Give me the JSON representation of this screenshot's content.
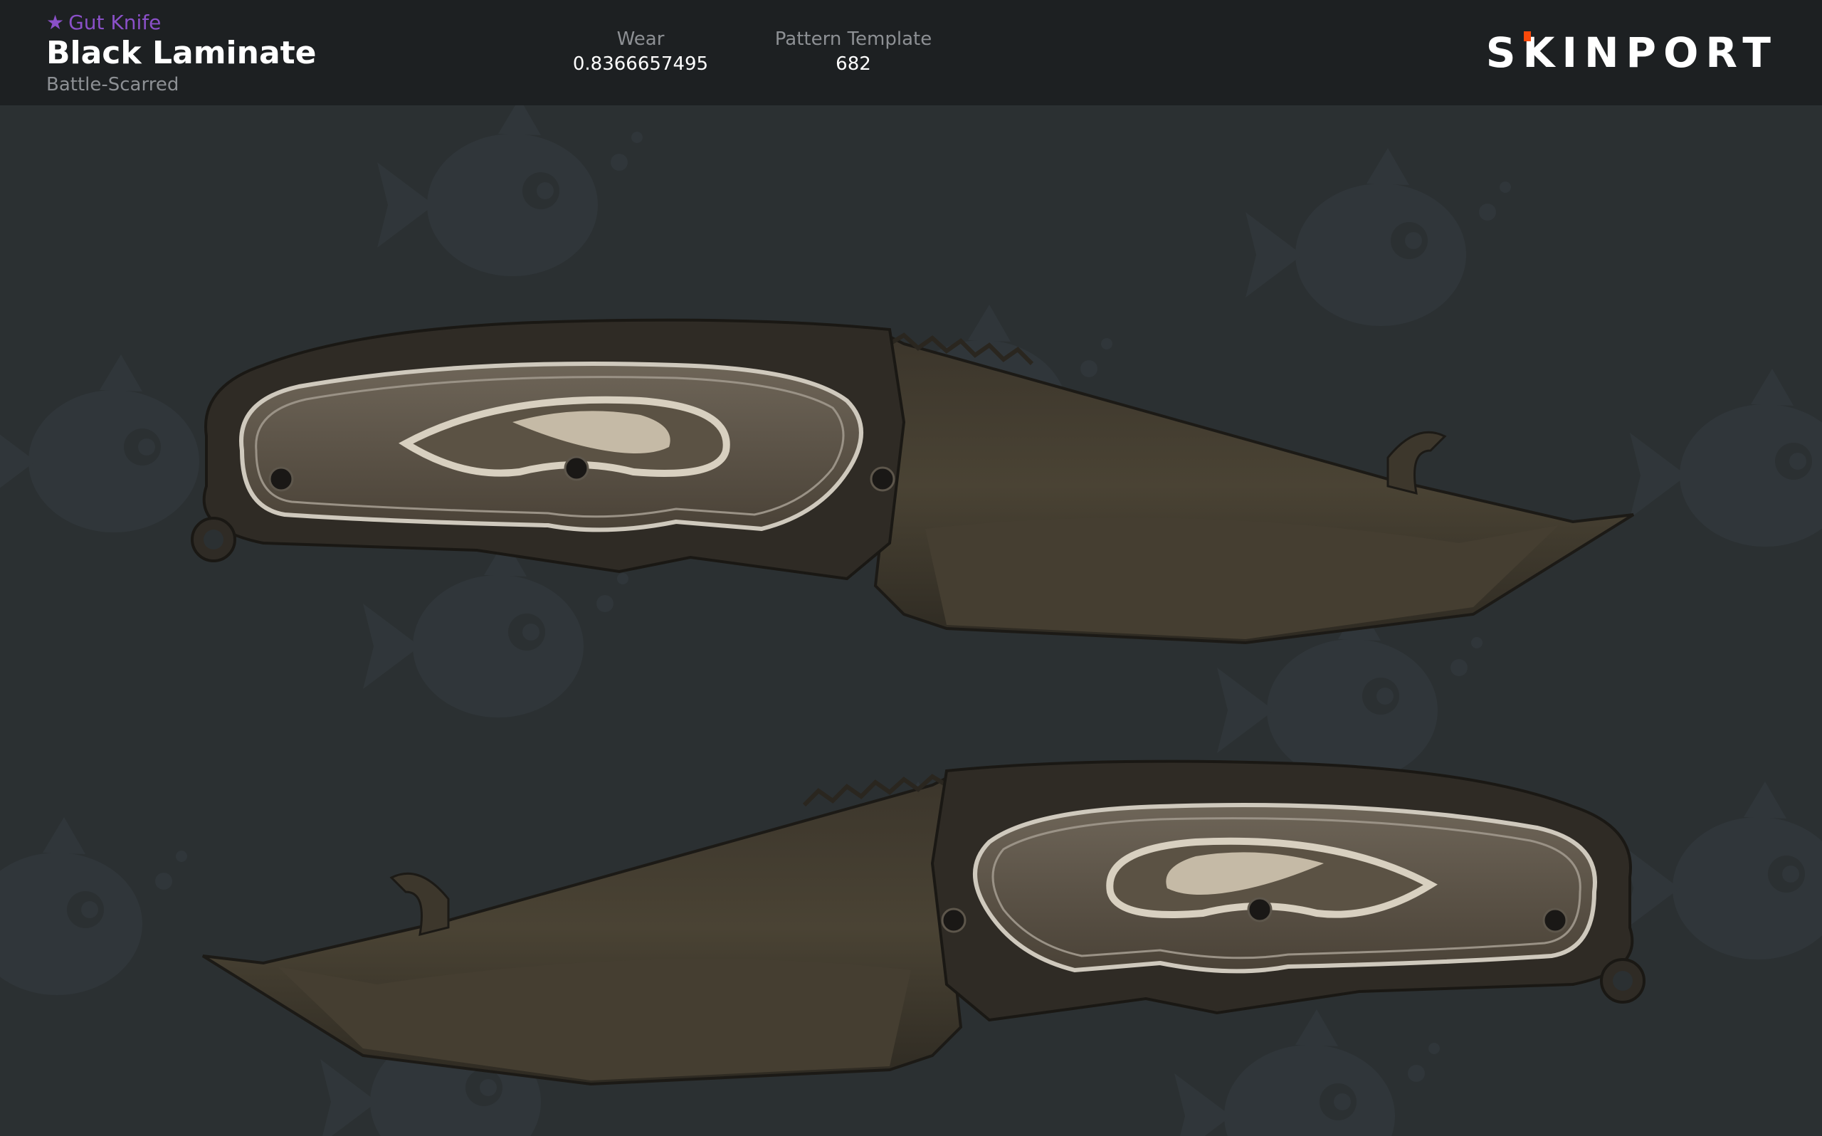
{
  "item": {
    "type_label": "Gut Knife",
    "star_icon": "★",
    "name": "Black Laminate",
    "exterior": "Battle-Scarred"
  },
  "stats": {
    "wear_label": "Wear",
    "wear_value": "0.8366657495",
    "pattern_label": "Pattern Template",
    "pattern_value": "682"
  },
  "brand": {
    "prefix": "S",
    "accent_letter": "K",
    "suffix": "INPORT"
  },
  "colors": {
    "rarity_purple": "#8a50c8",
    "brand_accent": "#fa490a",
    "header_bg": "#1d2022",
    "page_bg": "#2b3032"
  },
  "icons": {
    "rarity": "star-icon",
    "watermark": "fish-mascot-icon"
  }
}
